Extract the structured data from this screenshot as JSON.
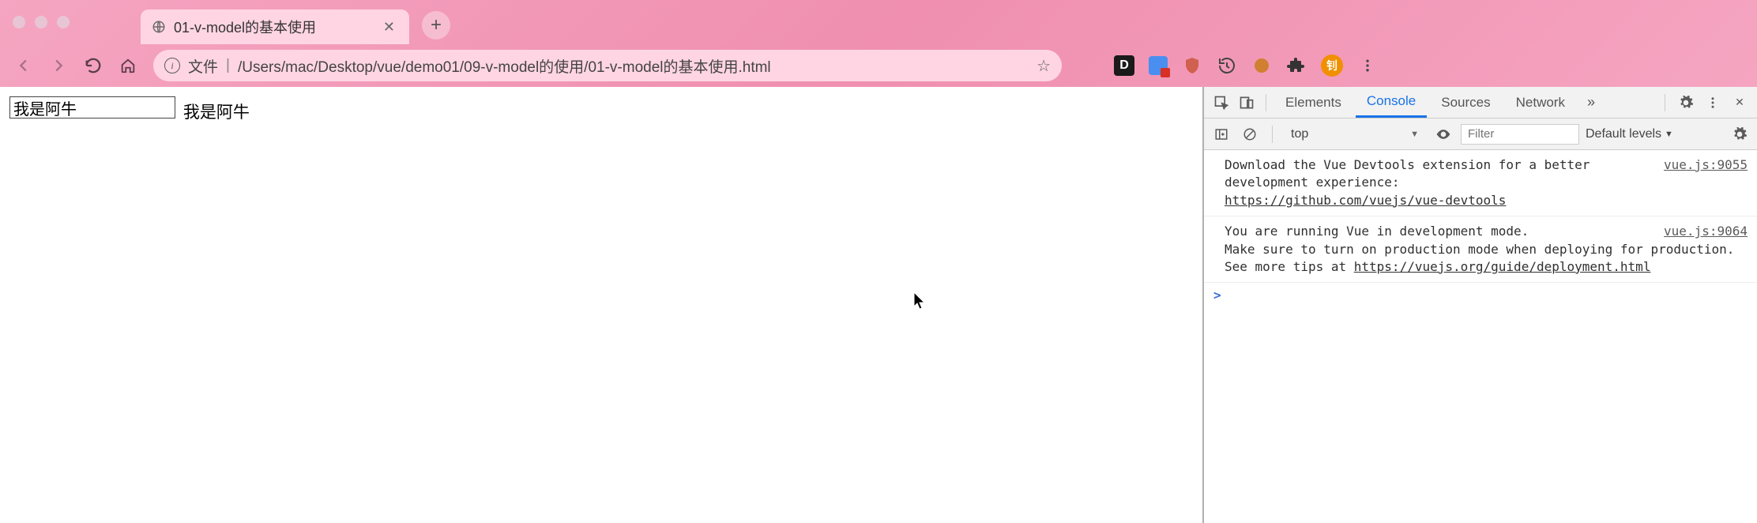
{
  "browser": {
    "tab_title": "01-v-model的基本使用",
    "address": {
      "file_label": "文件",
      "path": "/Users/mac/Desktop/vue/demo01/09-v-model的使用/01-v-model的基本使用.html"
    }
  },
  "page": {
    "input_value": "我是阿牛",
    "bound_text": "我是阿牛"
  },
  "devtools": {
    "tabs": [
      "Elements",
      "Console",
      "Sources",
      "Network"
    ],
    "active_tab": "Console",
    "context": "top",
    "filter_placeholder": "Filter",
    "levels": "Default levels",
    "logs": [
      {
        "text1": "Download the Vue Devtools extension for a better development experience:",
        "link": "https://github.com/vuejs/vue-devtools",
        "source": "vue.js:9055"
      },
      {
        "text1": "You are running Vue in development mode.",
        "text2": "Make sure to turn on production mode when deploying for production.",
        "text3": "See more tips at ",
        "link": "https://vuejs.org/guide/deployment.html",
        "source": "vue.js:9064"
      }
    ],
    "prompt": ">"
  },
  "ext_badge_text": "钊"
}
